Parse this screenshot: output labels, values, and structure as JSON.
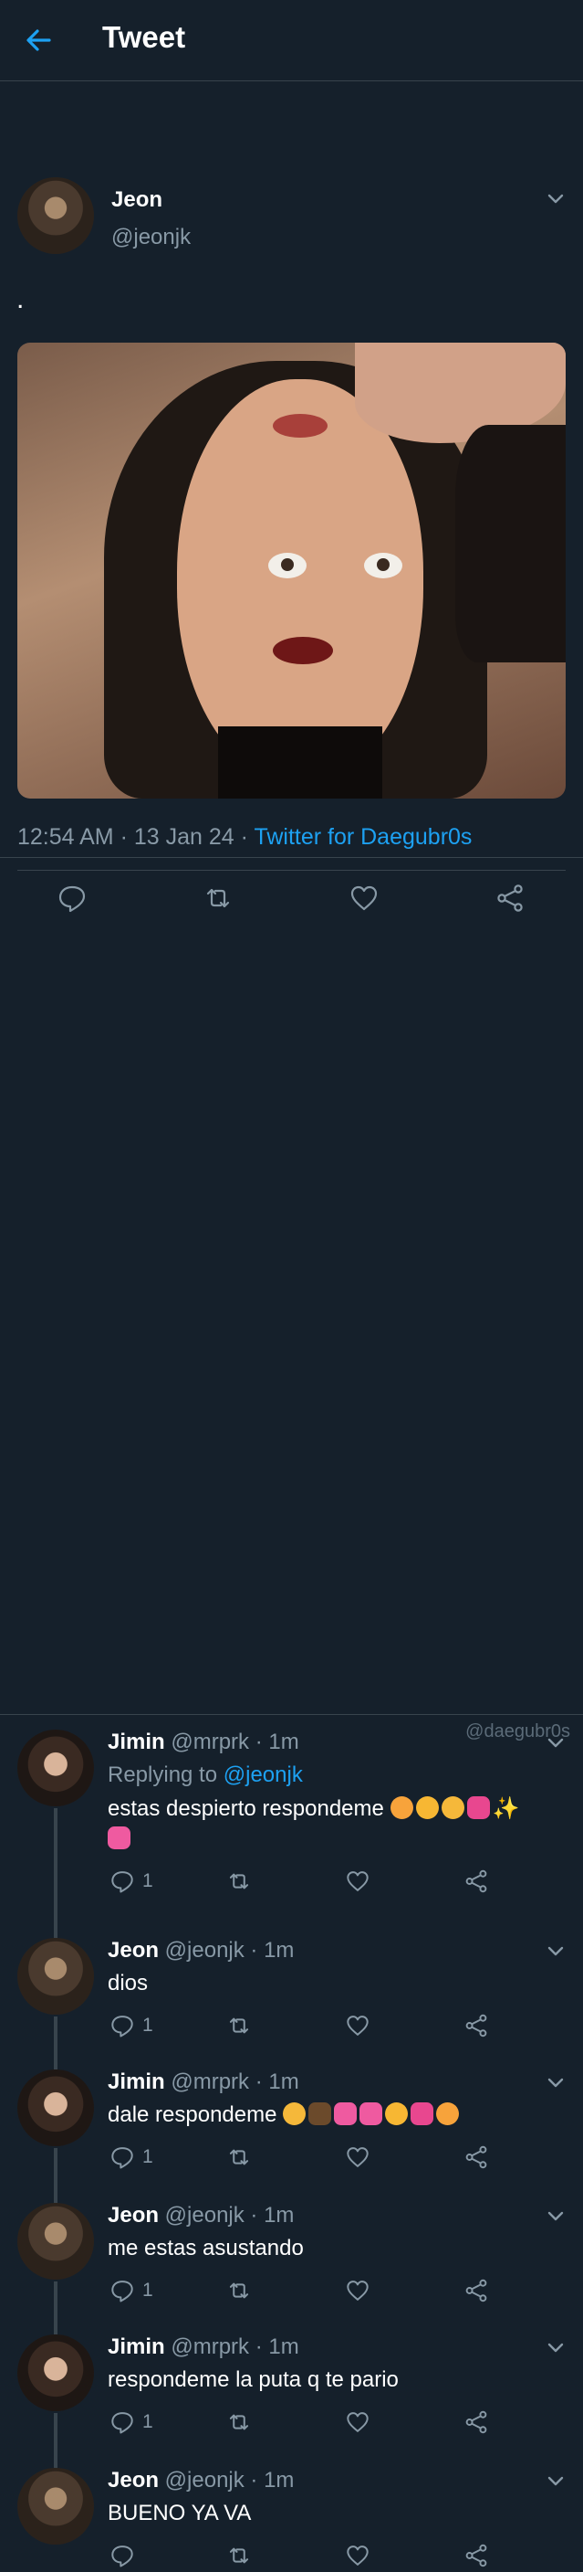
{
  "header": {
    "title": "Tweet",
    "back_icon": "arrow-left-icon"
  },
  "colors": {
    "background": "#15202b",
    "accent": "#1da1f2",
    "secondary_text": "#8899a6",
    "divider": "#38444d"
  },
  "main_tweet": {
    "name": "Jeon",
    "handle": "@jeonjk",
    "text": ".",
    "time": "12:54 AM · 13 Jan 24 · ",
    "source": "Twitter for Daegubr0s"
  },
  "replies": [
    {
      "name": "Jimin",
      "meta": " @mrprk · 1m",
      "replying_prefix": "Replying to ",
      "replying_handle": "@jeonjk",
      "text": "estas despierto respondeme",
      "text2": "",
      "reply_count": "1"
    },
    {
      "name": "Jeon",
      "meta": " @jeonjk · 1m",
      "text": "dios",
      "reply_count": "1"
    },
    {
      "name": "Jimin",
      "meta": " @mrprk · 1m",
      "text": "dale respondeme",
      "reply_count": "1"
    },
    {
      "name": "Jeon",
      "meta": " @jeonjk · 1m",
      "text": "me estas asustando",
      "reply_count": "1"
    },
    {
      "name": "Jimin",
      "meta": " @mrprk · 1m",
      "text": "respondeme la puta q te pario",
      "reply_count": "1"
    },
    {
      "name": "Jeon",
      "meta": " @jeonjk · 1m",
      "text": "BUENO YA VA",
      "reply_count": ""
    }
  ],
  "watermark": "@daegubr0s"
}
